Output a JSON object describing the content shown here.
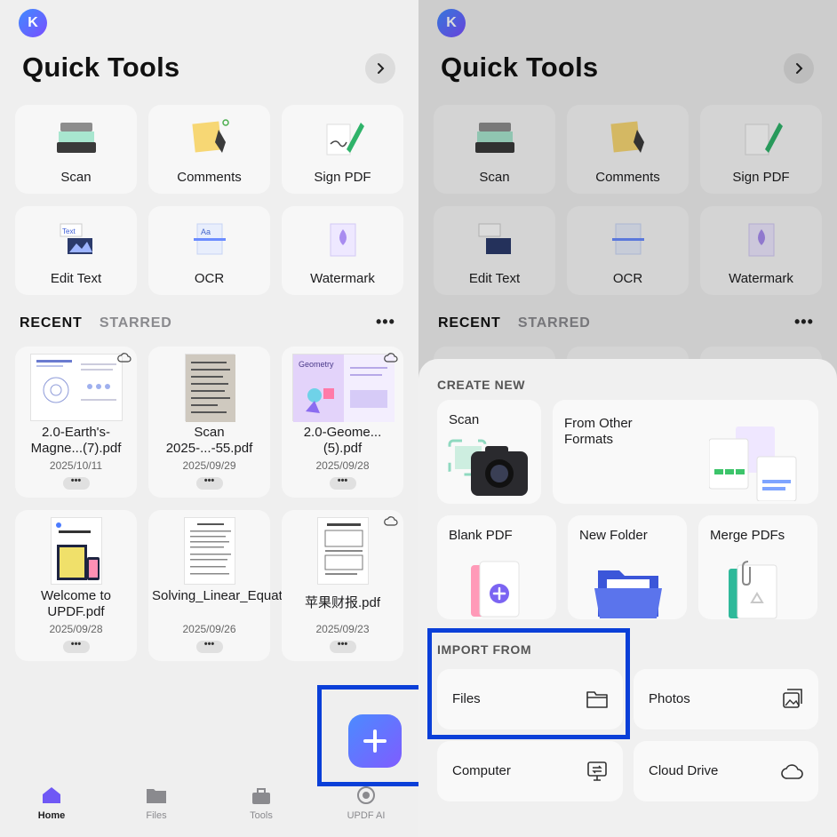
{
  "user": {
    "avatar_initial": "K"
  },
  "header": {
    "title": "Quick Tools"
  },
  "tools": [
    {
      "label": "Scan",
      "icon": "scanner-icon"
    },
    {
      "label": "Comments",
      "icon": "sticky-note-icon"
    },
    {
      "label": "Sign PDF",
      "icon": "signature-pen-icon"
    },
    {
      "label": "Edit Text",
      "icon": "edit-text-icon"
    },
    {
      "label": "OCR",
      "icon": "ocr-icon"
    },
    {
      "label": "Watermark",
      "icon": "watermark-icon"
    }
  ],
  "tabs": {
    "recent": "RECENT",
    "starred": "STARRED",
    "more": "•••"
  },
  "files": [
    {
      "name": "2.0-Earth's-Magne...(7).pdf",
      "date": "2025/10/11",
      "cloud": true
    },
    {
      "name": "Scan 2025-...-55.pdf",
      "date": "2025/09/29",
      "cloud": false
    },
    {
      "name": "2.0-Geome...(5).pdf",
      "date": "2025/09/28",
      "cloud": true,
      "thumb_title": "Geometry"
    },
    {
      "name": "Welcome to UPDF.pdf",
      "date": "2025/09/28",
      "cloud": false
    },
    {
      "name": "Solving_Linear_Equations.pdf",
      "date": "2025/09/26",
      "cloud": false
    },
    {
      "name": "苹果财报.pdf",
      "date": "2025/09/23",
      "cloud": true
    }
  ],
  "file_more": "•••",
  "nav": [
    {
      "label": "Home",
      "icon": "home-icon",
      "active": true
    },
    {
      "label": "Files",
      "icon": "folder-icon",
      "active": false
    },
    {
      "label": "Tools",
      "icon": "toolbox-icon",
      "active": false
    },
    {
      "label": "UPDF AI",
      "icon": "ai-icon",
      "active": false
    }
  ],
  "thumb_text": {
    "edit_text": "Text",
    "ocr": "Aa"
  },
  "create_new": {
    "title": "CREATE NEW",
    "scan": "Scan",
    "from_other": "From Other Formats",
    "blank_pdf": "Blank PDF",
    "new_folder": "New Folder",
    "merge_pdfs": "Merge PDFs"
  },
  "import_from": {
    "title": "IMPORT FROM",
    "files": "Files",
    "photos": "Photos",
    "computer": "Computer",
    "cloud_drive": "Cloud Drive"
  },
  "colors": {
    "accent": "#5b7cff",
    "highlight": "#0a3fd8",
    "card": "#f7f7f7",
    "background": "#efefef"
  }
}
